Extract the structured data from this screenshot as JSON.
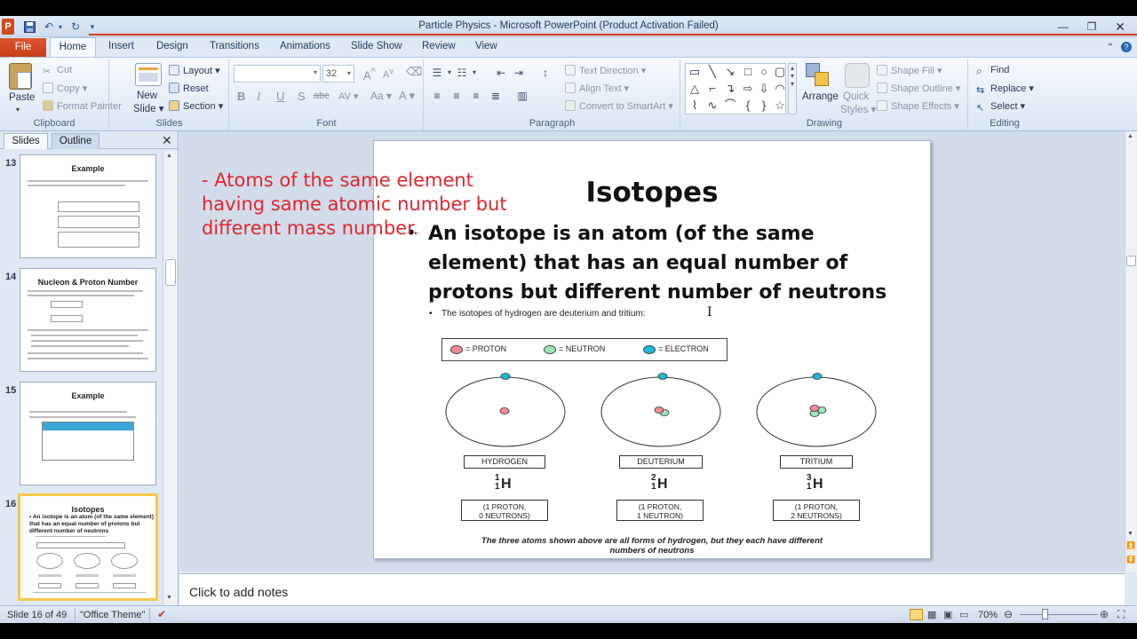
{
  "window": {
    "title": "Particle Physics  -  Microsoft PowerPoint (Product Activation Failed)"
  },
  "ribbon_tabs": [
    "File",
    "Home",
    "Insert",
    "Design",
    "Transitions",
    "Animations",
    "Slide Show",
    "Review",
    "View"
  ],
  "clipboard": {
    "paste": "Paste",
    "cut": "Cut",
    "copy": "Copy",
    "format_painter": "Format Painter",
    "label": "Clipboard"
  },
  "slides_group": {
    "new_slide_1": "New",
    "new_slide_2": "Slide",
    "layout": "Layout",
    "reset": "Reset",
    "section": "Section",
    "label": "Slides"
  },
  "font": {
    "name": "",
    "size": "32",
    "label": "Font",
    "bold": "B",
    "italic": "I",
    "underline": "U",
    "shadow": "S",
    "strike": "abc",
    "spacing": "AV",
    "case": "Aa",
    "color": "A"
  },
  "paragraph": {
    "text_direction": "Text Direction",
    "align_text": "Align Text",
    "convert_smartart": "Convert to SmartArt",
    "label": "Paragraph"
  },
  "drawing": {
    "arrange": "Arrange",
    "quick_styles_1": "Quick",
    "quick_styles_2": "Styles",
    "shape_fill": "Shape Fill",
    "shape_outline": "Shape Outline",
    "shape_effects": "Shape Effects",
    "label": "Drawing"
  },
  "editing": {
    "find": "Find",
    "replace": "Replace",
    "select": "Select",
    "label": "Editing"
  },
  "left_pane": {
    "tab_slides": "Slides",
    "tab_outline": "Outline"
  },
  "thumbnails": [
    {
      "num": "13",
      "title": "Example"
    },
    {
      "num": "14",
      "title": "Nucleon & Proton Number"
    },
    {
      "num": "15",
      "title": "Example"
    },
    {
      "num": "16",
      "title": "Isotopes",
      "bullet": "• An isotope is an atom (of the same element) that has an equal number of protons but different number of neutrons"
    }
  ],
  "overlay_note": "- Atoms of the same element having same atomic number but different mass number.",
  "slide": {
    "title": "Isotopes",
    "bullet_1": "An isotope is an atom (of the same element) that has an equal number of protons but different number of neutrons",
    "sub_bullet": "The isotopes of hydrogen are deuterium and tritium:",
    "legend": {
      "proton": "= PROTON",
      "neutron": "= NEUTRON",
      "electron": "= ELECTRON"
    },
    "atoms": [
      {
        "name": "HYDROGEN",
        "mass": "1",
        "atomic": "1",
        "symbol": "H",
        "line1": "(1 PROTON,",
        "line2": "0 NEUTRONS)"
      },
      {
        "name": "DEUTERIUM",
        "mass": "2",
        "atomic": "1",
        "symbol": "H",
        "line1": "(1 PROTON,",
        "line2": "1 NEUTRON)"
      },
      {
        "name": "TRITIUM",
        "mass": "3",
        "atomic": "1",
        "symbol": "H",
        "line1": "(1 PROTON,",
        "line2": "2 NEUTRONS)"
      }
    ],
    "caption_1": "The three atoms shown above are all forms of hydrogen, but they each have different",
    "caption_2": "numbers of neutrons"
  },
  "notes": {
    "placeholder": "Click to add notes"
  },
  "status": {
    "slide_info": "Slide 16 of 49",
    "theme": "\"Office Theme\"",
    "zoom": "70%"
  },
  "colors": {
    "proton": "#f48b95",
    "neutron": "#9fe3b8",
    "electron": "#1fb7d8",
    "accent_red": "#e0262e",
    "file_tab": "#d24a23"
  }
}
